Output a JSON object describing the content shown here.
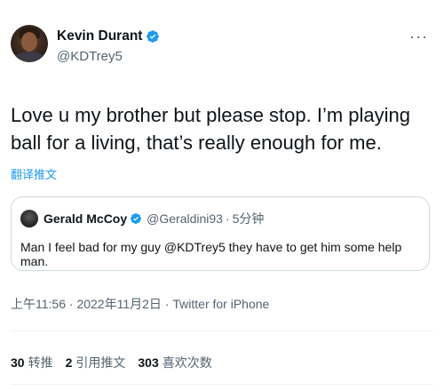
{
  "author": {
    "display_name": "Kevin Durant",
    "handle": "@KDTrey5",
    "verified": true
  },
  "more_label": "···",
  "tweet": {
    "text": "Love u my brother but please stop. I’m playing ball for a living, that’s really enough for me.",
    "translate_label": "翻译推文"
  },
  "quoted": {
    "display_name": "Gerald McCoy",
    "handle": "@Geraldini93",
    "separator": "·",
    "time": "5分钟",
    "text": "Man I feel bad for my guy @KDTrey5 they have to get him some help man."
  },
  "meta": {
    "time": "上午11:56",
    "separator1": "·",
    "date": "2022年11月2日",
    "separator2": "·",
    "source": "Twitter for iPhone"
  },
  "stats": [
    {
      "count": "30",
      "label": "转推"
    },
    {
      "count": "2",
      "label": "引用推文"
    },
    {
      "count": "303",
      "label": "喜欢次数"
    }
  ],
  "colors": {
    "accent": "#1d9bf0",
    "secondary_text": "#536471",
    "border": "#cfd9de"
  }
}
